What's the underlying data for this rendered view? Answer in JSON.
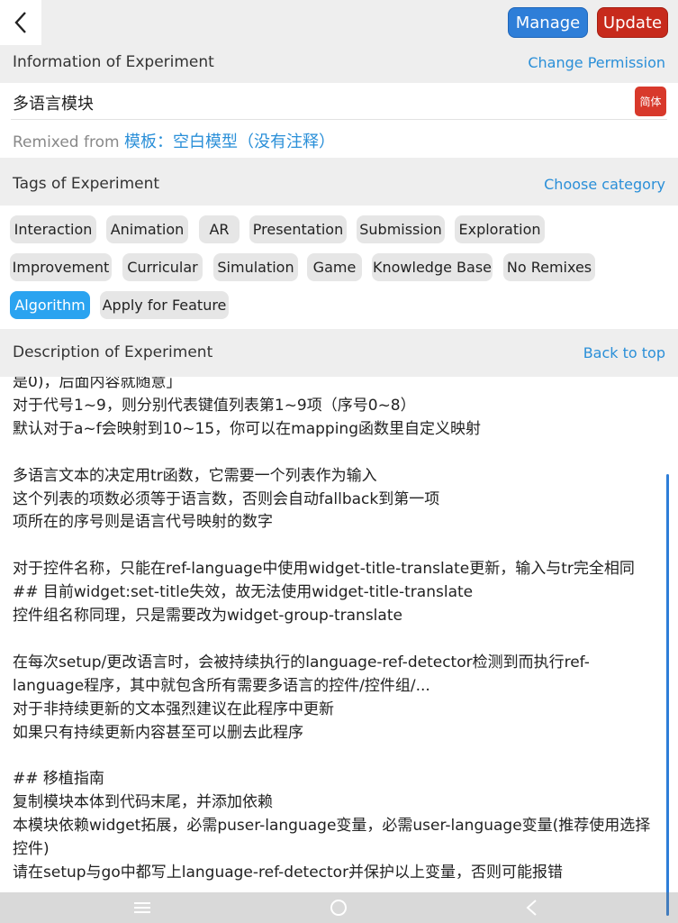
{
  "header": {
    "manage_label": "Manage",
    "update_label": "Update"
  },
  "info": {
    "title": "Information of Experiment",
    "link": "Change Permission",
    "name": "多语言模块",
    "language_badge": "简体",
    "remixed_prefix": "Remixed from ",
    "remixed_source": "模板：空白模型（没有注释）"
  },
  "tags_section": {
    "title": "Tags of Experiment",
    "link": "Choose category",
    "tags": [
      {
        "label": "Interaction",
        "active": false
      },
      {
        "label": "Animation",
        "active": false
      },
      {
        "label": "AR",
        "active": false
      },
      {
        "label": "Presentation",
        "active": false
      },
      {
        "label": "Submission",
        "active": false
      },
      {
        "label": "Exploration",
        "active": false
      },
      {
        "label": "Improvement",
        "active": false
      },
      {
        "label": "Curricular",
        "active": false
      },
      {
        "label": "Simulation",
        "active": false
      },
      {
        "label": "Game",
        "active": false
      },
      {
        "label": "Knowledge Base",
        "active": false
      },
      {
        "label": "No Remixes",
        "active": false
      },
      {
        "label": "Algorithm",
        "active": true
      },
      {
        "label": "Apply for Feature",
        "active": false
      }
    ]
  },
  "description": {
    "title": "Description of Experiment",
    "link": "Back to top",
    "text": "是0)，后面内容就随意」\n对于代号1~9，则分别代表键值列表第1~9项（序号0~8）\n默认对于a~f会映射到10~15，你可以在mapping函数里自定义映射\n\n多语言文本的决定用tr函数，它需要一个列表作为输入\n这个列表的项数必须等于语言数，否则会自动fallback到第一项\n项所在的序号则是语言代号映射的数字\n\n对于控件名称，只能在ref-language中使用widget-title-translate更新，输入与tr完全相同\n## 目前widget:set-title失效，故无法使用widget-title-translate\n控件组名称同理，只是需要改为widget-group-translate\n\n在每次setup/更改语言时，会被持续执行的language-ref-detector检测到而执行ref-language程序，其中就包含所有需要多语言的控件/控件组/...\n对于非持续更新的文本强烈建议在此程序中更新\n如果只有持续更新内容甚至可以删去此程序\n\n## 移植指南\n复制模块本体到代码末尾，并添加依赖\n本模块依赖widget拓展，必需puser-language变量，必需user-language变量(推荐使用选择控件)\n请在setup与go中都写上language-ref-detector并保护以上变量，否则可能报错"
  },
  "icons": {
    "back": "chevron-left-icon",
    "nav_menu": "menu-icon",
    "nav_home": "home-circle-icon",
    "nav_back": "triangle-back-icon"
  },
  "colors": {
    "accent_blue": "#2a8fd8",
    "manage_button": "#2e7ed8",
    "update_button": "#c72a1c",
    "active_tag": "#2aa3f0"
  }
}
